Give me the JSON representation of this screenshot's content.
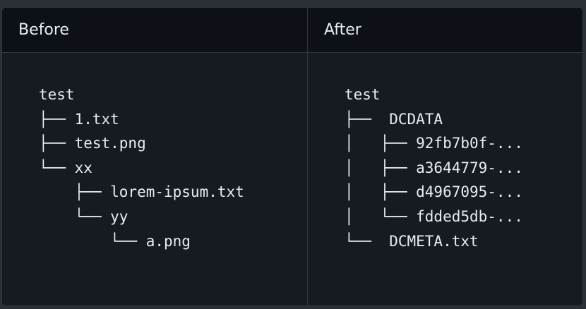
{
  "before": {
    "title": "Before",
    "lines": [
      "test",
      "├── 1.txt",
      "├── test.png",
      "└── xx",
      "    ├── lorem-ipsum.txt",
      "    └── yy",
      "        └── a.png"
    ]
  },
  "after": {
    "title": "After",
    "lines": [
      "test",
      "├──  DCDATA",
      "│   ├── 92fb7b0f-...",
      "│   ├── a3644779-...",
      "│   ├── d4967095-...",
      "│   └── fdded5db-...",
      "└──  DCMETA.txt"
    ]
  }
}
